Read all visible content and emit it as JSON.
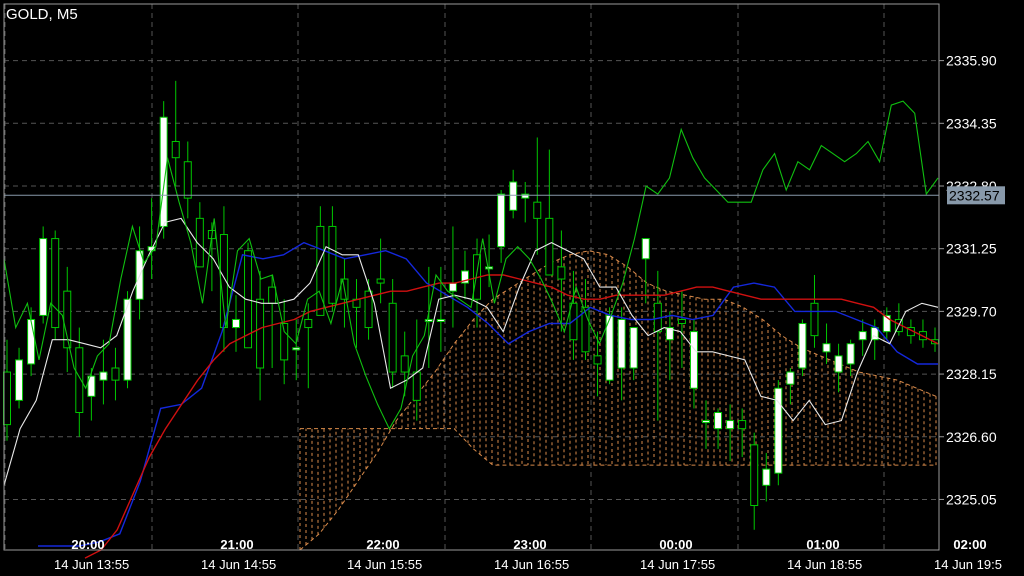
{
  "symbol": {
    "title": "GOLD, M5"
  },
  "colors": {
    "background": "#000000",
    "grid": "#555555",
    "frame": "#9a9a9a",
    "bull_candle": "#ffffff",
    "bear_candle": "#000000",
    "wick": "#00c800",
    "ma_red": "#d01010",
    "blue_line": "#1428dc",
    "white_line": "#e8e8e8",
    "chikou_green": "#10c010",
    "cloud": "#d88a4a",
    "current_price_bg": "#8899aa"
  },
  "chart_data": {
    "type": "candlestick",
    "ylim": [
      2323.8,
      2337.3
    ],
    "y_ticks": [
      "2335.90",
      "2334.35",
      "2332.80",
      "2331.25",
      "2329.70",
      "2328.15",
      "2326.60",
      "2325.05"
    ],
    "current_price": "2332.57",
    "time_labels_top": [
      "20:00",
      "21:00",
      "22:00",
      "23:00",
      "00:00",
      "01:00",
      "02:00"
    ],
    "time_labels_bottom": [
      "14 Jun 13:55",
      "14 Jun 14:55",
      "14 Jun 15:55",
      "14 Jun 16:55",
      "14 Jun 17:55",
      "14 Jun 18:55",
      "14 Jun 19:5"
    ],
    "candles": [
      [
        2328.2,
        2329.0,
        2326.5,
        2326.9
      ],
      [
        2327.5,
        2328.8,
        2327.3,
        2328.5
      ],
      [
        2328.4,
        2329.8,
        2328.1,
        2329.5
      ],
      [
        2329.6,
        2331.8,
        2329.4,
        2331.5
      ],
      [
        2331.5,
        2331.7,
        2329.0,
        2329.3
      ],
      [
        2330.2,
        2330.8,
        2328.2,
        2328.8
      ],
      [
        2328.8,
        2329.3,
        2326.6,
        2327.2
      ],
      [
        2327.6,
        2328.3,
        2327.0,
        2328.1
      ],
      [
        2328.0,
        2329.0,
        2327.4,
        2328.2
      ],
      [
        2328.3,
        2328.8,
        2327.5,
        2328.0
      ],
      [
        2328.0,
        2330.2,
        2327.8,
        2330.0
      ],
      [
        2330.0,
        2331.8,
        2329.5,
        2331.2
      ],
      [
        2331.2,
        2332.5,
        2330.5,
        2331.3
      ],
      [
        2331.8,
        2334.9,
        2331.5,
        2334.5
      ],
      [
        2333.9,
        2335.4,
        2332.8,
        2333.5
      ],
      [
        2333.4,
        2333.9,
        2332.0,
        2332.5
      ],
      [
        2332.0,
        2332.4,
        2330.8,
        2330.8
      ],
      [
        2331.7,
        2331.9,
        2330.2,
        2331.5
      ],
      [
        2331.6,
        2332.3,
        2328.7,
        2329.3
      ],
      [
        2329.3,
        2330.1,
        2328.7,
        2329.5
      ],
      [
        2331.2,
        2331.4,
        2328.8,
        2328.8
      ],
      [
        2330.0,
        2330.7,
        2327.5,
        2328.3
      ],
      [
        2330.3,
        2330.6,
        2328.3,
        2329.9
      ],
      [
        2329.4,
        2330.0,
        2327.9,
        2328.5
      ],
      [
        2328.8,
        2329.5,
        2328.0,
        2328.8
      ],
      [
        2329.5,
        2329.9,
        2327.8,
        2329.3
      ],
      [
        2331.8,
        2332.3,
        2330.7,
        2329.6
      ],
      [
        2331.8,
        2332.3,
        2329.7,
        2329.9
      ],
      [
        2330.5,
        2331.0,
        2329.3,
        2330.0
      ],
      [
        2330.0,
        2330.5,
        2328.8,
        2329.8
      ],
      [
        2330.2,
        2330.5,
        2329.0,
        2329.3
      ],
      [
        2330.5,
        2331.5,
        2329.9,
        2330.4
      ],
      [
        2329.9,
        2330.5,
        2327.8,
        2328.2
      ],
      [
        2328.6,
        2329.2,
        2327.6,
        2328.2
      ],
      [
        2328.2,
        2329.5,
        2327.0,
        2327.5
      ],
      [
        2329.5,
        2330.8,
        2328.3,
        2329.5
      ],
      [
        2329.5,
        2330.8,
        2328.7,
        2329.5
      ],
      [
        2330.2,
        2331.8,
        2329.3,
        2330.4
      ],
      [
        2330.4,
        2331.2,
        2330.0,
        2330.7
      ],
      [
        2331.1,
        2331.5,
        2329.3,
        2330.0
      ],
      [
        2330.8,
        2331.6,
        2330.3,
        2330.8
      ],
      [
        2331.3,
        2332.7,
        2330.9,
        2332.6
      ],
      [
        2332.2,
        2333.2,
        2332.0,
        2332.9
      ],
      [
        2332.5,
        2332.9,
        2331.9,
        2332.6
      ],
      [
        2332.4,
        2334.0,
        2331.1,
        2332.0
      ],
      [
        2332.0,
        2333.7,
        2331.5,
        2330.6
      ],
      [
        2330.8,
        2331.7,
        2329.2,
        2330.5
      ],
      [
        2329.9,
        2330.7,
        2328.5,
        2329.0
      ],
      [
        2329.8,
        2330.5,
        2328.5,
        2328.7
      ],
      [
        2328.6,
        2329.2,
        2327.6,
        2328.4
      ],
      [
        2328.0,
        2329.8,
        2327.9,
        2329.6
      ],
      [
        2328.3,
        2329.8,
        2327.5,
        2329.5
      ],
      [
        2328.3,
        2329.3,
        2328.0,
        2329.3
      ],
      [
        2331.0,
        2331.5,
        2329.9,
        2331.5
      ],
      [
        2329.9,
        2330.7,
        2327.0,
        2329.2
      ],
      [
        2329.0,
        2329.7,
        2328.0,
        2329.3
      ],
      [
        2329.5,
        2330.2,
        2328.3,
        2329.4
      ],
      [
        2327.8,
        2329.5,
        2327.3,
        2329.2
      ],
      [
        2327.0,
        2327.5,
        2326.3,
        2327.0
      ],
      [
        2326.8,
        2327.3,
        2326.3,
        2327.2
      ],
      [
        2326.8,
        2327.4,
        2326.0,
        2327.0
      ],
      [
        2327.0,
        2327.3,
        2326.1,
        2326.8
      ],
      [
        2326.4,
        2326.7,
        2324.3,
        2324.9
      ],
      [
        2325.4,
        2326.2,
        2325.0,
        2325.8
      ],
      [
        2325.7,
        2328.0,
        2325.4,
        2327.8
      ],
      [
        2327.9,
        2328.3,
        2327.4,
        2328.2
      ],
      [
        2328.3,
        2329.5,
        2328.1,
        2329.4
      ],
      [
        2329.9,
        2330.6,
        2328.8,
        2329.1
      ],
      [
        2328.7,
        2329.4,
        2328.4,
        2328.9
      ],
      [
        2328.2,
        2328.9,
        2327.7,
        2328.6
      ],
      [
        2328.4,
        2329.0,
        2328.1,
        2328.9
      ],
      [
        2329.0,
        2329.5,
        2328.6,
        2329.2
      ],
      [
        2329.0,
        2329.5,
        2328.5,
        2329.3
      ],
      [
        2329.2,
        2329.8,
        2329.0,
        2329.6
      ],
      [
        2329.5,
        2329.9,
        2329.1,
        2329.2
      ],
      [
        2329.3,
        2329.5,
        2328.9,
        2329.1
      ],
      [
        2329.2,
        2329.5,
        2328.8,
        2329.0
      ],
      [
        2329.0,
        2329.3,
        2328.7,
        2328.9
      ]
    ],
    "ma_red": [
      2323.6,
      2323.8,
      2324.3,
      2325.2,
      2326.1,
      2326.8,
      2327.4,
      2328.0,
      2328.5,
      2328.9,
      2329.1,
      2329.3,
      2329.4,
      2329.5,
      2329.7,
      2329.8,
      2329.9,
      2330.0,
      2330.1,
      2330.2,
      2330.2,
      2330.3,
      2330.4,
      2330.4,
      2330.5,
      2330.6,
      2330.6,
      2330.5,
      2330.4,
      2330.3,
      2330.1,
      2330.0,
      2330.0,
      2330.1,
      2330.1,
      2330.1,
      2330.1,
      2330.2,
      2330.3,
      2330.3,
      2330.2,
      2330.1,
      2330.0,
      2330.0,
      2330.0,
      2330.0,
      2330.0,
      2330.0,
      2329.9,
      2329.8,
      2329.5,
      2329.3,
      2329.1,
      2328.9
    ],
    "blue_line": [
      2323.9,
      2323.9,
      2323.9,
      2324.0,
      2324.2,
      2325.5,
      2327.3,
      2327.4,
      2327.8,
      2329.2,
      2331.1,
      2331.0,
      2331.1,
      2331.4,
      2331.2,
      2331.0,
      2331.1,
      2331.2,
      2331.0,
      2330.4,
      2330.1,
      2329.8,
      2329.4,
      2328.9,
      2329.2,
      2329.4,
      2329.4,
      2329.8,
      2329.6,
      2329.5,
      2329.5,
      2329.6,
      2329.5,
      2329.6,
      2330.3,
      2330.4,
      2330.3,
      2329.7,
      2329.7,
      2329.7,
      2329.5,
      2329.3,
      2328.7,
      2328.4,
      2328.4
    ],
    "white_line": [
      2325.4,
      2326.8,
      2327.5,
      2329.0,
      2329.0,
      2328.9,
      2328.8,
      2329.1,
      2330.2,
      2331.1,
      2331.9,
      2332.0,
      2331.4,
      2331.0,
      2330.3,
      2330.0,
      2329.9,
      2329.9,
      2330.0,
      2330.4,
      2331.3,
      2331.1,
      2331.1,
      2329.9,
      2327.8,
      2328.0,
      2328.3,
      2330.0,
      2330.1,
      2330.0,
      2329.8,
      2329.2,
      2330.3,
      2331.2,
      2331.4,
      2331.2,
      2331.0,
      2330.3,
      2330.3,
      2329.6,
      2329.1,
      2329.3,
      2329.2,
      2328.7,
      2328.7,
      2328.6,
      2328.5,
      2327.6,
      2327.5,
      2327.0,
      2327.5,
      2326.9,
      2327.0,
      2328.2,
      2329.1,
      2328.9,
      2329.7,
      2329.9,
      2329.8
    ],
    "chikou_green": [
      2331.0,
      2329.3,
      2329.9,
      2328.5,
      2329.9,
      2329.6,
      2328.3,
      2327.8,
      2328.6,
      2328.9,
      2330.5,
      2331.8,
      2330.9,
      2331.3,
      2333.5,
      2332.4,
      2331.4,
      2329.9,
      2332.0,
      2329.3,
      2331.2,
      2331.5,
      2330.5,
      2330.6,
      2329.2,
      2328.9,
      2330.0,
      2330.2,
      2329.4,
      2330.5,
      2328.9,
      2328.1,
      2327.4,
      2326.8,
      2327.3,
      2328.6,
      2329.1,
      2330.6,
      2330.2,
      2330.0,
      2329.8,
      2331.5,
      2329.9,
      2331.0,
      2331.3,
      2331.0,
      2330.5,
      2329.9,
      2329.2,
      2330.3,
      2329.5,
      2328.9,
      2329.6,
      2330.4,
      2331.5,
      2332.8,
      2332.6,
      2333.0,
      2334.2,
      2333.5,
      2333.0,
      2332.7,
      2332.4,
      2332.4,
      2332.4,
      2333.2,
      2333.6,
      2332.7,
      2333.4,
      2333.2,
      2333.8,
      2333.6,
      2333.4,
      2333.6,
      2333.9,
      2333.4,
      2334.8,
      2334.9,
      2334.6,
      2332.6,
      2333.0
    ],
    "cloud_a": [
      2323.8,
      2324.2,
      2324.8,
      2325.5,
      2326.2,
      2327.0,
      2327.6,
      2328.2,
      2328.9,
      2329.5,
      2330.0,
      2330.3,
      2330.6,
      2330.9,
      2331.1,
      2331.2,
      2331.1,
      2330.8,
      2330.4,
      2330.2,
      2330.1,
      2330.0,
      2330.0,
      2329.8,
      2329.5,
      2329.1,
      2328.8,
      2328.6,
      2328.4,
      2328.2,
      2328.1,
      2328.0,
      2327.8,
      2327.6
    ],
    "cloud_b": [
      2326.8,
      2326.8,
      2326.8,
      2326.8,
      2326.8,
      2326.8,
      2326.8,
      2326.8,
      2326.8,
      2326.3,
      2325.9,
      2325.9,
      2325.9,
      2325.9,
      2325.9,
      2325.9,
      2325.9,
      2325.9,
      2325.9,
      2325.9,
      2325.9,
      2325.9,
      2325.9,
      2325.9,
      2325.9,
      2325.9,
      2325.9,
      2325.9,
      2325.9,
      2325.9,
      2325.9,
      2325.9,
      2325.9,
      2325.9
    ]
  }
}
